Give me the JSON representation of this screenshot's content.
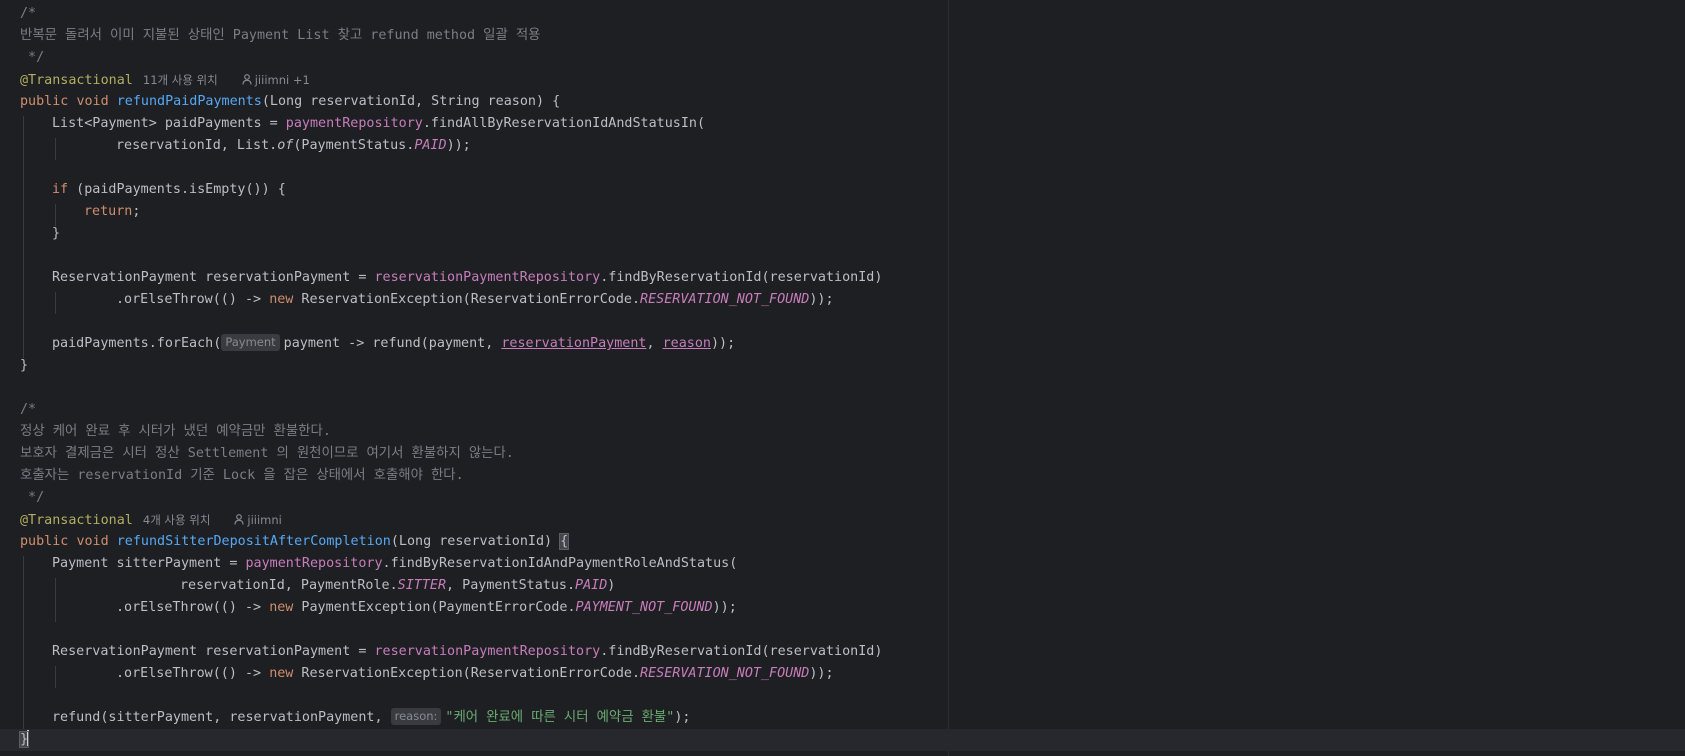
{
  "editor": {
    "comment1": {
      "open": "/*",
      "text": "반복문 돌려서 이미 지불된 상태인 Payment List 찾고 refund method 일괄 적용",
      "close": " */"
    },
    "method1": {
      "annotation": "@Transactional",
      "usages": "11개 사용 위치",
      "author": "jiiimni +1",
      "kw_public": "public",
      "kw_void": "void",
      "name": "refundPaidPayments",
      "params": "(Long reservationId, String reason) {",
      "l1_a": "List<Payment> paidPayments = ",
      "l1_field": "paymentRepository",
      "l1_b": ".findAllByReservationIdAndStatusIn(",
      "l2_a": "reservationId, List.",
      "l2_of": "of",
      "l2_b": "(PaymentStatus.",
      "l2_const": "PAID",
      "l2_c": "));",
      "l3_if": "if",
      "l3_b": " (paidPayments.isEmpty()) {",
      "l4_return": "return",
      "l4_semi": ";",
      "l5": "}",
      "l6_a": "ReservationPayment reservationPayment = ",
      "l6_field": "reservationPaymentRepository",
      "l6_b": ".findByReservationId(reservationId)",
      "l7_a": ".orElseThrow(() -> ",
      "l7_new": "new",
      "l7_b": " ReservationException(ReservationErrorCode.",
      "l7_const": "RESERVATION_NOT_FOUND",
      "l7_c": "));",
      "l8_a": "paidPayments.forEach(",
      "l8_hint": "Payment",
      "l8_b": "payment -> refund(payment, ",
      "l8_u1": "reservationPayment",
      "l8_comma": ", ",
      "l8_u2": "reason",
      "l8_c": "));",
      "close": "}"
    },
    "comment2": {
      "open": "/*",
      "line1": "정상 케어 완료 후 시터가 냈던 예약금만 환불한다.",
      "line2": "보호자 결제금은 시터 정산 Settlement 의 원천이므로 여기서 환불하지 않는다.",
      "line3": "호출자는 reservationId 기준 Lock 을 잡은 상태에서 호출해야 한다.",
      "close": " */"
    },
    "method2": {
      "annotation": "@Transactional",
      "usages": "4개 사용 위치",
      "author": "jiiimni",
      "kw_public": "public",
      "kw_void": "void",
      "name": "refundSitterDepositAfterCompletion",
      "params": "(Long reservationId) ",
      "brace": "{",
      "l1_a": "Payment sitterPayment = ",
      "l1_field": "paymentRepository",
      "l1_b": ".findByReservationIdAndPaymentRoleAndStatus(",
      "l2_a": "reservationId, PaymentRole.",
      "l2_const1": "SITTER",
      "l2_b": ", PaymentStatus.",
      "l2_const2": "PAID",
      "l2_c": ")",
      "l3_a": ".orElseThrow(() -> ",
      "l3_new": "new",
      "l3_b": " PaymentException(PaymentErrorCode.",
      "l3_const": "PAYMENT_NOT_FOUND",
      "l3_c": "));",
      "l4_a": "ReservationPayment reservationPayment = ",
      "l4_field": "reservationPaymentRepository",
      "l4_b": ".findByReservationId(reservationId)",
      "l5_a": ".orElseThrow(() -> ",
      "l5_new": "new",
      "l5_b": " ReservationException(ReservationErrorCode.",
      "l5_const": "RESERVATION_NOT_FOUND",
      "l5_c": "));",
      "l6_a": "refund(sitterPayment, reservationPayment, ",
      "l6_hint": "reason:",
      "l6_str": "\"케어 완료에 따른 시터 예약금 환불\"",
      "l6_c": ");",
      "close": "}"
    }
  },
  "icons": {
    "author": "person-icon"
  },
  "colors": {
    "background": "#1e1f22",
    "keyword": "#cf8e6d",
    "annotation": "#b3ae60",
    "method": "#56a8f5",
    "field": "#c77dbb",
    "string": "#6aab73",
    "comment": "#7a7e85"
  }
}
